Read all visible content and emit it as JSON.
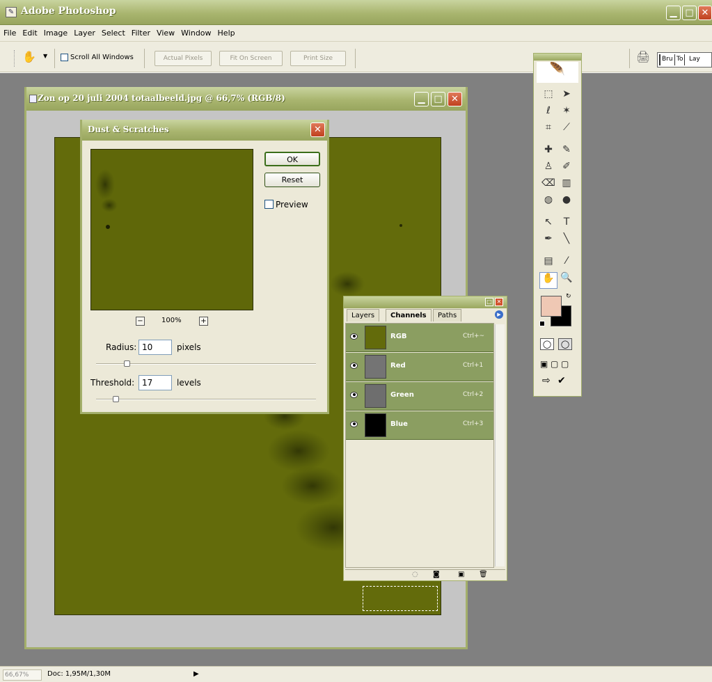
{
  "app": {
    "title": "Adobe Photoshop",
    "menu": [
      "File",
      "Edit",
      "Image",
      "Layer",
      "Select",
      "Filter",
      "View",
      "Window",
      "Help"
    ]
  },
  "options": {
    "scroll_all_label": "Scroll All Windows",
    "actual_pixels": "Actual Pixels",
    "fit_on_screen": "Fit On Screen",
    "print_size": "Print Size",
    "well_tabs": [
      "Bru",
      "To",
      "Lay"
    ]
  },
  "document": {
    "title": "Zon op 20 juli 2004 totaalbeeld.jpg @ 66,7% (RGB/8)"
  },
  "dust_dialog": {
    "title": "Dust & Scratches",
    "ok": "OK",
    "reset": "Reset",
    "preview": "Preview",
    "zoom": "100%",
    "minus": "−",
    "plus": "+",
    "radius_label": "Radius:",
    "radius_value": "10",
    "radius_unit": "pixels",
    "threshold_label": "Threshold:",
    "threshold_value": "17",
    "threshold_unit": "levels"
  },
  "channels_palette": {
    "tabs": [
      "Layers",
      "Channels",
      "Paths"
    ],
    "channels": [
      {
        "name": "RGB",
        "shortcut": "Ctrl+~"
      },
      {
        "name": "Red",
        "shortcut": "Ctrl+1"
      },
      {
        "name": "Green",
        "shortcut": "Ctrl+2"
      },
      {
        "name": "Blue",
        "shortcut": "Ctrl+3"
      }
    ]
  },
  "status": {
    "zoom": "66,67%",
    "doc": "Doc: 1,95M/1,30M"
  },
  "colors": {
    "foreground": "#efc8b4",
    "background": "#000000",
    "canvas": "#636b0b"
  }
}
